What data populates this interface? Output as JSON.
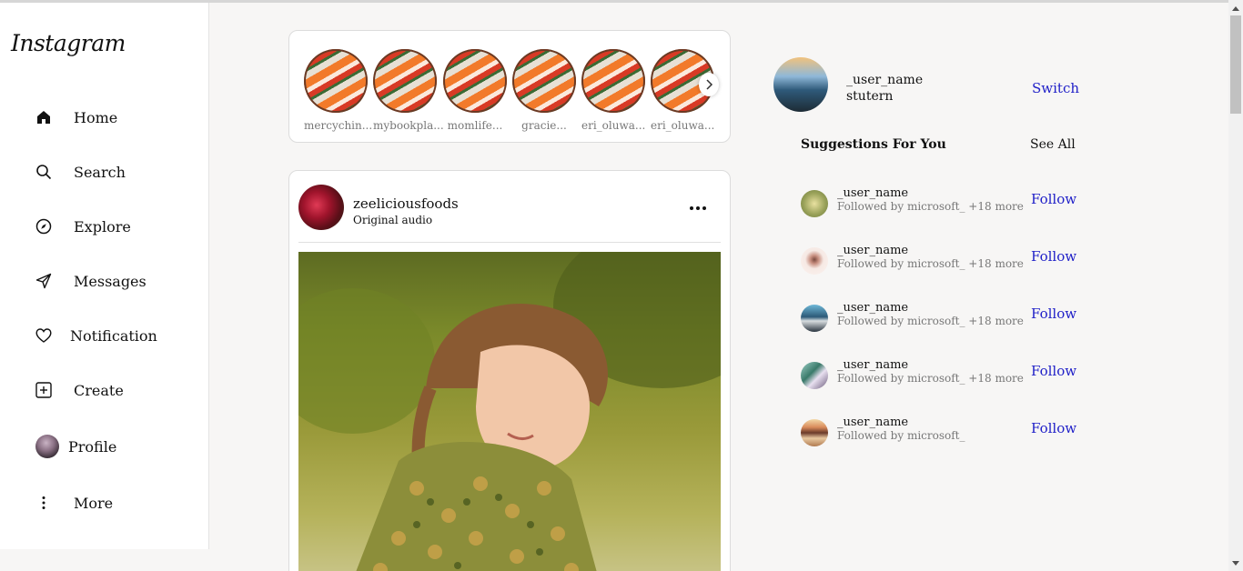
{
  "app": {
    "logo": "Instagram"
  },
  "sidebar": {
    "items": [
      {
        "label": "Home",
        "icon": "home-icon"
      },
      {
        "label": "Search",
        "icon": "search-icon"
      },
      {
        "label": "Explore",
        "icon": "compass-icon"
      },
      {
        "label": "Messages",
        "icon": "send-icon"
      },
      {
        "label": "Notification",
        "icon": "heart-icon"
      },
      {
        "label": "Create",
        "icon": "plus-square-icon"
      },
      {
        "label": "Profile",
        "icon": "avatar"
      },
      {
        "label": "More",
        "icon": "more-vertical-icon"
      }
    ]
  },
  "stories": [
    {
      "username": "mercychin..."
    },
    {
      "username": "mybookpla..."
    },
    {
      "username": "momlife..."
    },
    {
      "username": "gracie..."
    },
    {
      "username": "eri_oluwa..."
    },
    {
      "username": "eri_oluwa..."
    }
  ],
  "post": {
    "username": "zeeliciousfoods",
    "subtitle": "Original audio"
  },
  "me": {
    "username": "_user_name",
    "name": "stutern",
    "switch_label": "Switch"
  },
  "suggestions": {
    "title": "Suggestions For You",
    "see_all": "See All",
    "items": [
      {
        "username": "_user_name",
        "followed_by": "Followed by microsoft_ +18 more",
        "follow": "Follow"
      },
      {
        "username": "_user_name",
        "followed_by": "Followed by microsoft_ +18 more",
        "follow": "Follow"
      },
      {
        "username": "_user_name",
        "followed_by": "Followed by microsoft_ +18 more",
        "follow": "Follow"
      },
      {
        "username": "_user_name",
        "followed_by": "Followed by microsoft_ +18 more",
        "follow": "Follow"
      },
      {
        "username": "_user_name",
        "followed_by": "Followed by microsoft_",
        "follow": "Follow"
      }
    ]
  },
  "colors": {
    "link": "#2020c8",
    "background": "#f7f6f5"
  }
}
